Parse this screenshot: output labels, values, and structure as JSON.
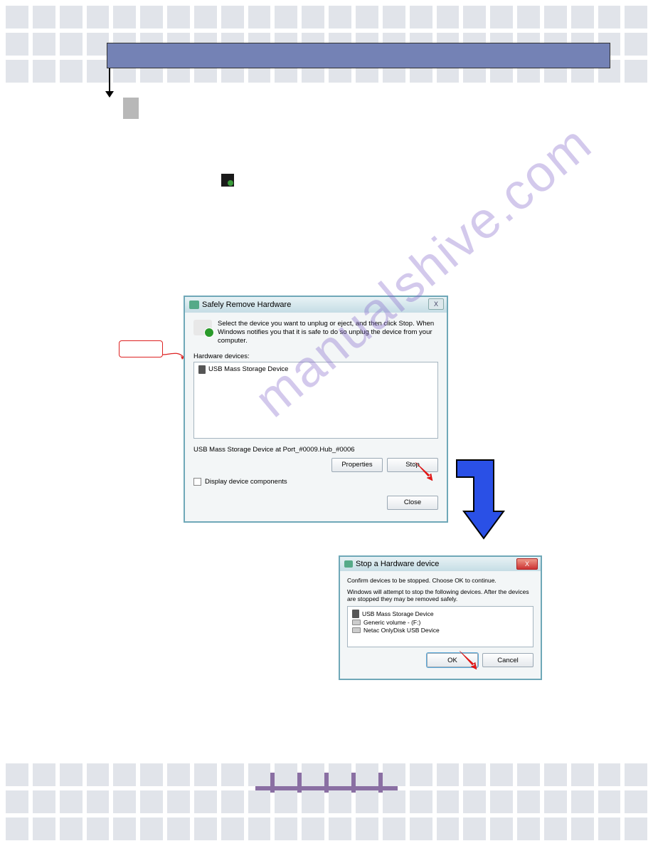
{
  "watermark": "manualshive.com",
  "dialog1": {
    "title": "Safely Remove Hardware",
    "info": "Select the device you want to unplug or eject, and then click Stop. When Windows notifies you that it is safe to do so unplug the device from your computer.",
    "hw_label": "Hardware devices:",
    "device": "USB Mass Storage Device",
    "status": "USB Mass Storage Device at Port_#0009.Hub_#0006",
    "properties_btn": "Properties",
    "stop_btn": "Stop",
    "display_components": "Display device components",
    "close_btn": "Close"
  },
  "dialog2": {
    "title": "Stop a Hardware device",
    "confirm": "Confirm devices to be stopped. Choose OK to continue.",
    "attempt": "Windows will attempt to stop the following devices. After the devices are stopped they may be removed safely.",
    "dev1": "USB Mass Storage Device",
    "dev2": "Generic volume - (F:)",
    "dev3": "Netac OnlyDisk USB Device",
    "ok_btn": "OK",
    "cancel_btn": "Cancel"
  }
}
